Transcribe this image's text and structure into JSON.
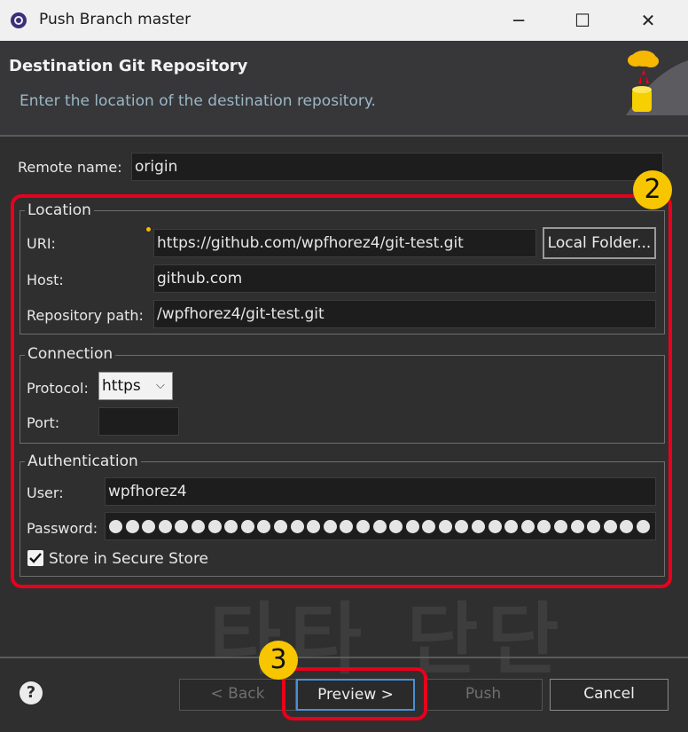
{
  "window": {
    "title": "Push Branch master",
    "controls": {
      "minimize": "─",
      "maximize": "☐",
      "close": "✕"
    }
  },
  "header": {
    "title": "Destination Git Repository",
    "description": "Enter the location of the destination repository."
  },
  "remote": {
    "label": "Remote name:",
    "value": "origin"
  },
  "location": {
    "group_label": "Location",
    "uri_label": "URI:",
    "uri_value": "https://github.com/wpfhorez4/git-test.git",
    "local_folder_button": "Local Folder...",
    "host_label": "Host:",
    "host_value": "github.com",
    "repo_path_label": "Repository path:",
    "repo_path_value": "/wpfhorez4/git-test.git"
  },
  "connection": {
    "group_label": "Connection",
    "protocol_label": "Protocol:",
    "protocol_value": "https",
    "port_label": "Port:",
    "port_value": ""
  },
  "authentication": {
    "group_label": "Authentication",
    "user_label": "User:",
    "user_value": "wpfhorez4",
    "password_label": "Password:",
    "store_label": "Store in Secure Store",
    "store_checked": true
  },
  "watermark": "타타 단단",
  "annotations": {
    "badge_2": "2",
    "badge_3": "3",
    "highlight_color": "#e8001c",
    "badge_color": "#f7c600"
  },
  "footer": {
    "help_icon": "?",
    "back_button": "< Back",
    "preview_button": "Preview >",
    "push_button": "Push",
    "cancel_button": "Cancel"
  }
}
